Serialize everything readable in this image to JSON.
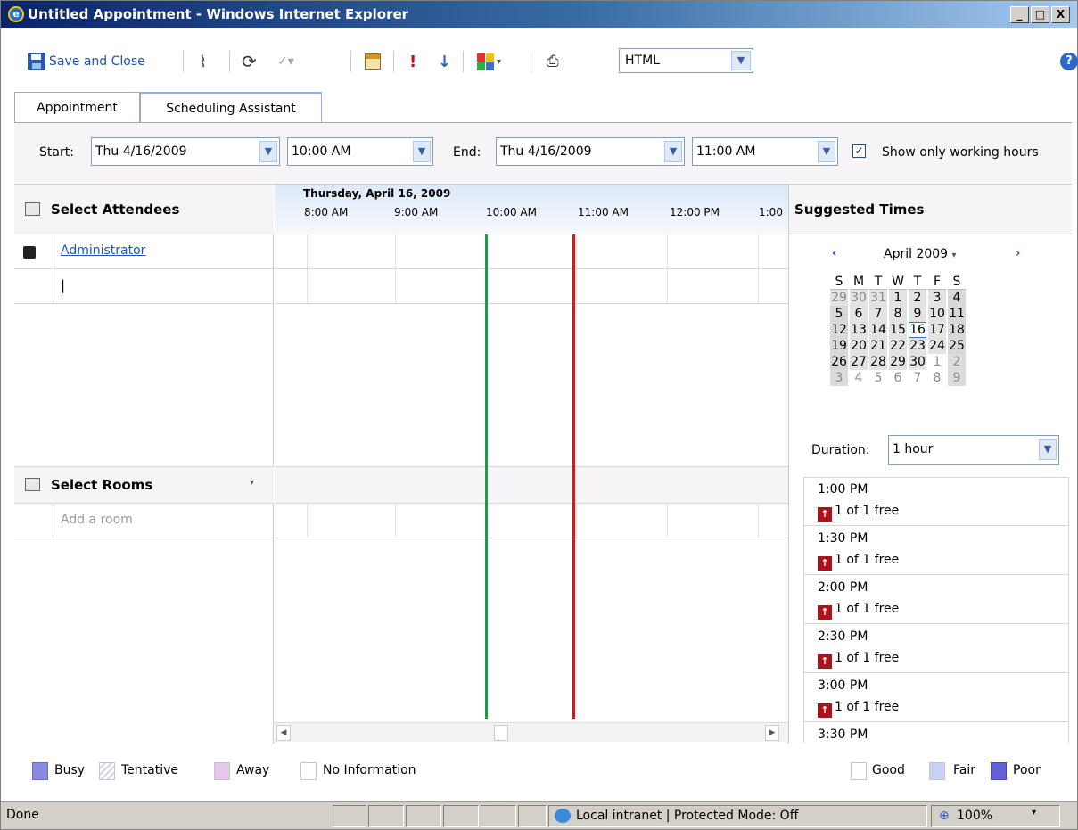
{
  "window": {
    "title": "Untitled Appointment - Windows Internet Explorer",
    "controls": [
      "_",
      "□",
      "X"
    ]
  },
  "toolbar": {
    "save_label": "Save and Close",
    "format_value": "HTML",
    "icons": [
      "floppy-icon",
      "paperclip-icon",
      "recurrence-icon",
      "spellcheck-icon",
      "calendar-grid-icon",
      "high-importance-icon",
      "low-importance-icon",
      "categorize-icon",
      "print-icon",
      "help-icon"
    ]
  },
  "tabs": [
    {
      "label": "Appointment"
    },
    {
      "label": "Scheduling Assistant",
      "active": true
    }
  ],
  "range": {
    "start_label": "Start:",
    "start_date": "Thu 4/16/2009",
    "start_time": "10:00 AM",
    "end_label": "End:",
    "end_date": "Thu 4/16/2009",
    "end_time": "11:00 AM",
    "working_hours_label": "Show only working hours",
    "working_hours_checked": true
  },
  "attendees": {
    "header": "Select Attendees",
    "items": [
      {
        "name": "Administrator"
      }
    ],
    "new_entry": "|"
  },
  "rooms": {
    "header": "Select Rooms",
    "placeholder": "Add a room"
  },
  "timeline": {
    "date": "Thursday, April 16, 2009",
    "hours": [
      "8:00 AM",
      "9:00 AM",
      "10:00 AM",
      "11:00 AM",
      "12:00 PM",
      "1:00"
    ]
  },
  "suggested": {
    "header": "Suggested Times",
    "calendar": {
      "month": "April 2009",
      "days_of_week": [
        "S",
        "M",
        "T",
        "W",
        "T",
        "F",
        "S"
      ],
      "weeks": [
        [
          "29",
          "30",
          "31",
          "1",
          "2",
          "3",
          "4"
        ],
        [
          "5",
          "6",
          "7",
          "8",
          "9",
          "10",
          "11"
        ],
        [
          "12",
          "13",
          "14",
          "15",
          "16",
          "17",
          "18"
        ],
        [
          "19",
          "20",
          "21",
          "22",
          "23",
          "24",
          "25"
        ],
        [
          "26",
          "27",
          "28",
          "29",
          "30",
          "1",
          "2"
        ],
        [
          "3",
          "4",
          "5",
          "6",
          "7",
          "8",
          "9"
        ]
      ],
      "selected": "16"
    },
    "duration_label": "Duration:",
    "duration_value": "1 hour",
    "slots": [
      {
        "time": "1:00 PM",
        "free": "1 of 1 free"
      },
      {
        "time": "1:30 PM",
        "free": "1 of 1 free"
      },
      {
        "time": "2:00 PM",
        "free": "1 of 1 free"
      },
      {
        "time": "2:30 PM",
        "free": "1 of 1 free"
      },
      {
        "time": "3:00 PM",
        "free": "1 of 1 free"
      },
      {
        "time": "3:30 PM",
        "free": ""
      }
    ]
  },
  "legend": {
    "left": [
      {
        "label": "Busy",
        "color": "#8a8ae0"
      },
      {
        "label": "Tentative",
        "color": "#e8e8f4"
      },
      {
        "label": "Away",
        "color": "#e6c6f0"
      },
      {
        "label": "No Information",
        "color": "#ffffff"
      }
    ],
    "right": [
      {
        "label": "Good",
        "color": "#ffffff"
      },
      {
        "label": "Fair",
        "color": "#c8d0f4"
      },
      {
        "label": "Poor",
        "color": "#6460d8"
      }
    ]
  },
  "status": {
    "text": "Done",
    "zone": "Local intranet | Protected Mode: Off",
    "zoom": "100%"
  },
  "colors": {
    "start_line": "#1f9a4a",
    "end_line": "#d11a1a",
    "accent": "#8cb0e6"
  }
}
